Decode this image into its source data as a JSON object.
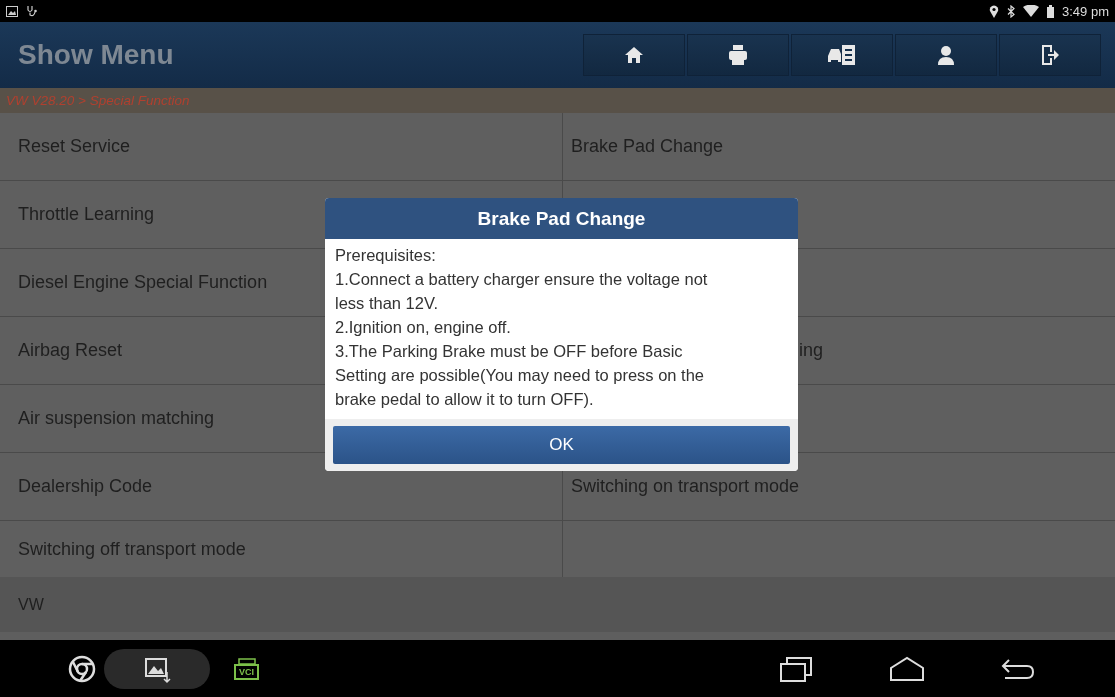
{
  "status_bar": {
    "time": "3:49 pm"
  },
  "header": {
    "title": "Show Menu"
  },
  "breadcrumb": "VW V28.20 > Special Function",
  "menu_rows": [
    {
      "left": {
        "label": "Reset Service",
        "kind": "full"
      },
      "right": {
        "label": "Brake Pad Change",
        "kind": "full"
      }
    },
    {
      "left": {
        "label": "Throttle Learning",
        "kind": "full"
      },
      "right": null
    },
    {
      "left": {
        "label": "Diesel Engine Special Function",
        "kind": "full"
      },
      "right": null
    },
    {
      "left": {
        "label": "Airbag Reset",
        "kind": "full"
      },
      "right": {
        "label": "ing",
        "kind": "tail"
      }
    },
    {
      "left": {
        "label": "Air suspension matching",
        "kind": "full"
      },
      "right": null
    },
    {
      "left": {
        "label": "Dealership Code",
        "kind": "full"
      },
      "right": {
        "label": "Switching on transport mode",
        "kind": "full"
      }
    },
    {
      "left": {
        "label": "Switching off transport mode",
        "kind": "full"
      },
      "right": null
    }
  ],
  "footer": {
    "label": "VW"
  },
  "dialog": {
    "title": "Brake Pad Change",
    "paragraphs": [
      "Prerequisites:",
      "1.Connect a battery charger ensure the voltage not less than 12V.",
      "2.Ignition on, engine off.",
      "3.The Parking Brake must be OFF before Basic Setting are possible(You may need to press on the brake pedal to allow it to turn OFF)."
    ],
    "button": "OK"
  },
  "nav_bar": {
    "vci_label": "VCI"
  }
}
